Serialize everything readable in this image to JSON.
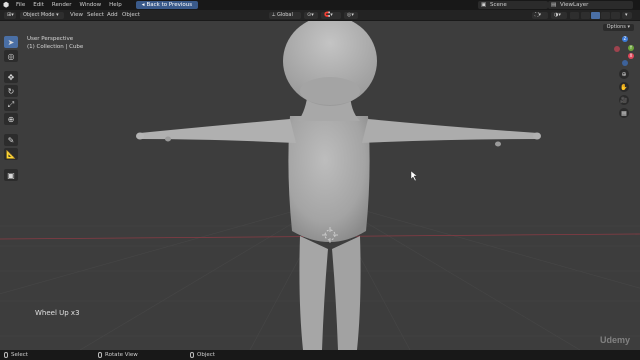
{
  "topbar": {
    "menus": [
      "File",
      "Edit",
      "Render",
      "Window",
      "Help"
    ],
    "back_label": "Back to Previous",
    "scene": "Scene",
    "view_layer": "ViewLayer"
  },
  "header": {
    "mode": "Object Mode",
    "menus": [
      "View",
      "Select",
      "Add",
      "Object"
    ],
    "orientation": "Global",
    "options_label": "Options"
  },
  "viewport": {
    "view_name": "User Perspective",
    "collection": "(1) Collection | Cube",
    "last_operation": "Wheel Up x3"
  },
  "gizmo": {
    "x_label": "X",
    "y_label": "Y",
    "z_label": "Z"
  },
  "statusbar": {
    "select": "Select",
    "rotate": "Rotate View",
    "object": "Object"
  },
  "watermark": "Udemy",
  "colors": {
    "background": "#3d3d3d",
    "accent": "#4a6fa5",
    "x_axis": "#e0475a",
    "y_axis": "#6ca43a",
    "z_axis": "#3d7bd8"
  }
}
